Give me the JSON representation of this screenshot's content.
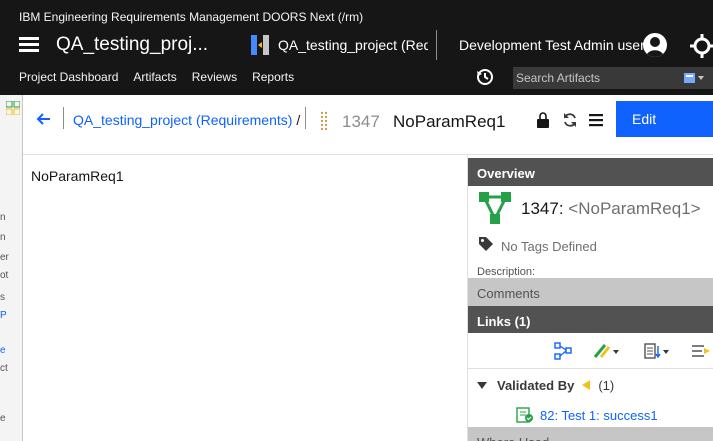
{
  "app": {
    "title": "IBM Engineering Requirements Management DOORS Next (/rm)",
    "project_name": "QA_testing_proj...",
    "project_switcher_label": "QA_testing_project (Requ",
    "user_name": "Development Test Admin user"
  },
  "nav": {
    "items": [
      {
        "label": "Project Dashboard"
      },
      {
        "label": "Artifacts"
      },
      {
        "label": "Reviews"
      },
      {
        "label": "Reports"
      }
    ],
    "search_placeholder": "Search Artifacts"
  },
  "artifact_header": {
    "breadcrumb": "QA_testing_project (Requirements)",
    "breadcrumb_sep": "/",
    "id": "1347",
    "name": "NoParamReq1",
    "edit_label": "Edit"
  },
  "content": {
    "body_text": "NoParamReq1"
  },
  "panel": {
    "overview_heading": "Overview",
    "overview_id": "1347:",
    "overview_name": "<NoParamReq1>",
    "tags_text": "No Tags Defined",
    "description_label": "Description:",
    "comments_heading": "Comments",
    "links_heading": "Links (1)",
    "validated_by_label": "Validated By",
    "validated_by_count": "(1)",
    "link_item": "82: Test 1: success1",
    "where_used_heading": "Where Used"
  },
  "left_strip": {
    "fragments": [
      "n",
      "n",
      "er",
      "ot",
      "s",
      "P",
      "e",
      "ct",
      "e"
    ]
  },
  "colors": {
    "topbar": "#161616",
    "accent": "#0f62fe",
    "section_header": "#525252",
    "section_header_light": "#c6c6c6"
  }
}
